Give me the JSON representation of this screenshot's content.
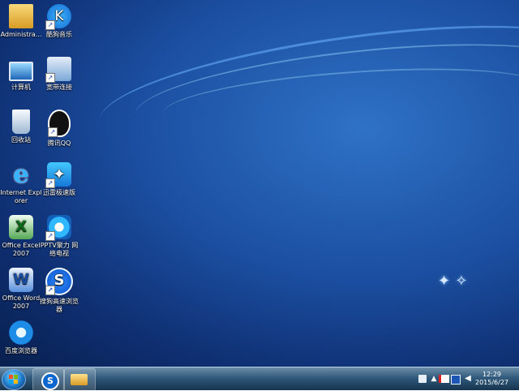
{
  "desktop": {
    "icons": [
      {
        "label": "Administra...",
        "icon": "user-folder-icon"
      },
      {
        "label": "酷狗音乐",
        "icon": "kugou-music-icon"
      },
      {
        "label": "计算机",
        "icon": "computer-icon"
      },
      {
        "label": "宽带连接",
        "icon": "network-connection-icon"
      },
      {
        "label": "回收站",
        "icon": "recycle-bin-icon"
      },
      {
        "label": "腾讯QQ",
        "icon": "qq-penguin-icon"
      },
      {
        "label": "Internet Explorer",
        "icon": "internet-explorer-icon"
      },
      {
        "label": "迅雷极速版",
        "icon": "xunlei-bird-icon"
      },
      {
        "label": "Office Excel 2007",
        "icon": "excel-icon"
      },
      {
        "label": "PPTV聚力 网络电视",
        "icon": "pptv-icon"
      },
      {
        "label": "Office Word 2007",
        "icon": "word-icon"
      },
      {
        "label": "搜狗高速浏览器",
        "icon": "sogou-browser-icon"
      },
      {
        "label": "百度浏览器",
        "icon": "baidu-browser-icon"
      }
    ]
  },
  "taskbar": {
    "start_icon": "windows-start-icon",
    "pinned": [
      {
        "icon": "sogou-browser-icon"
      },
      {
        "icon": "file-explorer-icon"
      }
    ],
    "tray": [
      {
        "icon": "keyboard-icon"
      },
      {
        "icon": "show-hidden-icons-icon"
      },
      {
        "icon": "action-center-flag-icon"
      },
      {
        "icon": "network-icon"
      },
      {
        "icon": "volume-icon"
      }
    ],
    "clock": {
      "time": "12:29",
      "date": "2015/6/27"
    }
  }
}
